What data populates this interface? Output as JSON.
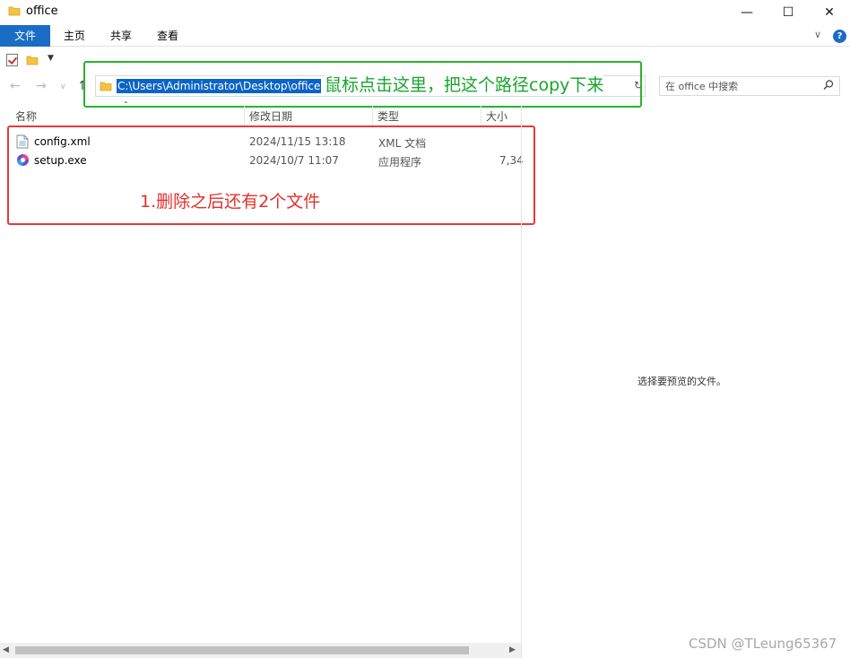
{
  "window": {
    "title": "office",
    "minimize_glyph": "—",
    "maximize_glyph": "☐",
    "close_glyph": "✕"
  },
  "ribbon": {
    "tabs": [
      {
        "label": "文件",
        "active": true
      },
      {
        "label": "主页"
      },
      {
        "label": "共享"
      },
      {
        "label": "查看"
      }
    ],
    "expand_glyph": "∨",
    "help_glyph": "?"
  },
  "nav": {
    "back_glyph": "←",
    "forward_glyph": "→",
    "recent_glyph": "∨",
    "up_glyph": "↑",
    "address_path": "C:\\Users\\Administrator\\Desktop\\office",
    "refresh_glyph": "↻",
    "search_placeholder": "在 office 中搜索"
  },
  "columns": {
    "name": "名称",
    "date": "修改日期",
    "type": "类型",
    "size": "大小"
  },
  "files": [
    {
      "name": "config.xml",
      "date": "2024/11/15 13:18",
      "type": "XML 文档",
      "size": "",
      "icon": "xml-file-icon"
    },
    {
      "name": "setup.exe",
      "date": "2024/10/7 11:07",
      "type": "应用程序",
      "size": "7,34",
      "icon": "office-setup-icon"
    }
  ],
  "annotations": {
    "green_note": "鼠标点击这里，把这个路径copy下来",
    "red_note": "1.删除之后还有2个文件",
    "green_color": "#27b52a",
    "red_color": "#e23b3b"
  },
  "preview": {
    "empty_text": "选择要预览的文件。"
  },
  "watermark": "CSDN @TLeung65367",
  "colors": {
    "accent": "#1a6cc4",
    "selection": "#0a64c8"
  }
}
